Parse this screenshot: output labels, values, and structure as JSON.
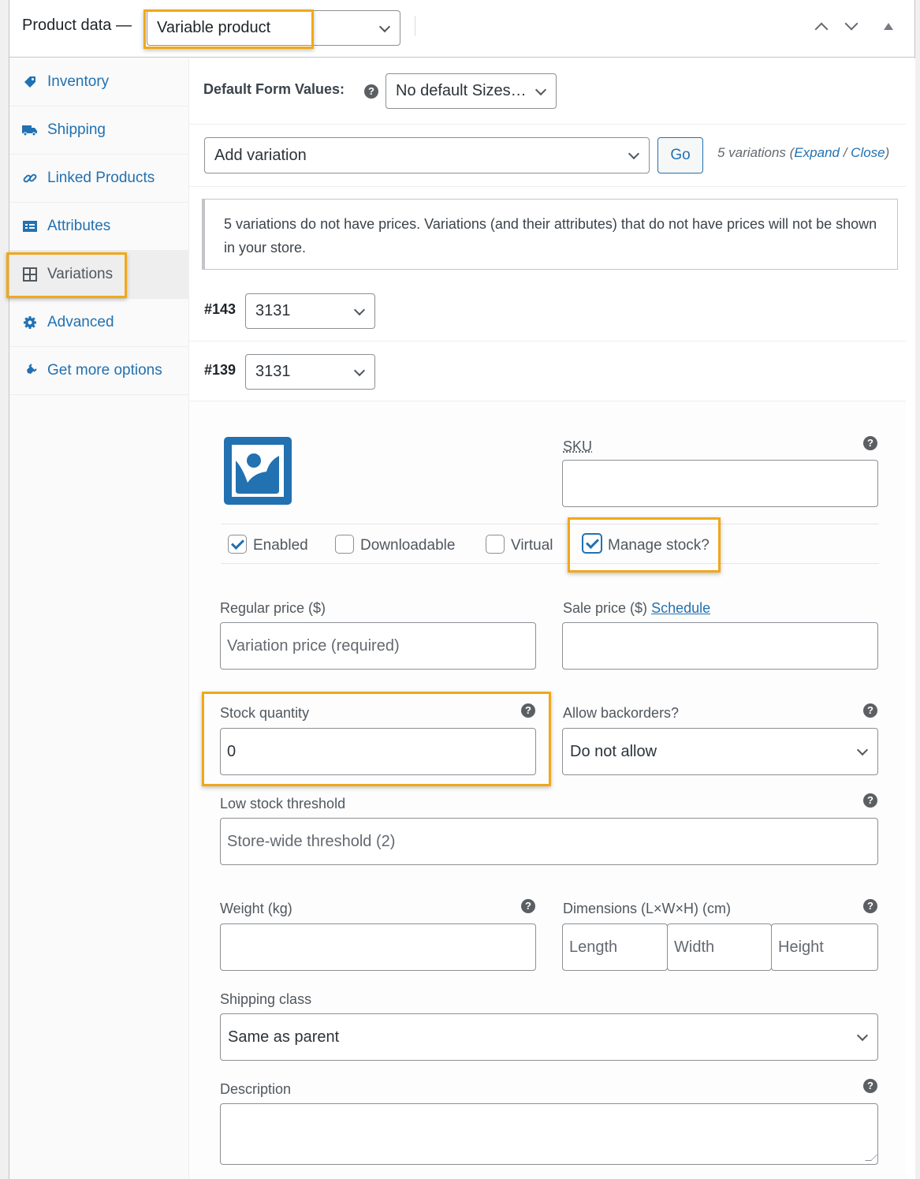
{
  "header": {
    "title": "Product data —",
    "product_type": "Variable product"
  },
  "sidebar": {
    "items": [
      {
        "label": "Inventory",
        "icon": "tag-icon"
      },
      {
        "label": "Shipping",
        "icon": "truck-icon"
      },
      {
        "label": "Linked Products",
        "icon": "link-icon"
      },
      {
        "label": "Attributes",
        "icon": "list-icon"
      },
      {
        "label": "Variations",
        "icon": "grid-icon",
        "active": true
      },
      {
        "label": "Advanced",
        "icon": "gear-icon"
      },
      {
        "label": "Get more options",
        "icon": "plugin-icon"
      }
    ]
  },
  "defaults": {
    "label": "Default Form Values:",
    "select_value": "No default Sizes…"
  },
  "bulk": {
    "action_value": "Add variation",
    "go_label": "Go",
    "count_text": "5 variations",
    "expand_label": "Expand",
    "separator": " / ",
    "close_label": "Close"
  },
  "notice": {
    "text": "5 variations do not have prices. Variations (and their attributes) that do not have prices will not be shown in your store."
  },
  "variations": [
    {
      "id": "#143",
      "value": "3131"
    },
    {
      "id": "#139",
      "value": "3131"
    }
  ],
  "variation_form": {
    "sku_label": "SKU",
    "sku_value": "",
    "checkboxes": [
      {
        "label": "Enabled",
        "checked": true
      },
      {
        "label": "Downloadable",
        "checked": false
      },
      {
        "label": "Virtual",
        "checked": false
      },
      {
        "label": "Manage stock?",
        "checked": true
      }
    ],
    "regular_price_label": "Regular price ($)",
    "regular_price_placeholder": "Variation price (required)",
    "sale_price_label": "Sale price ($)",
    "schedule_label": "Schedule",
    "stock_quantity_label": "Stock quantity",
    "stock_quantity_value": "0",
    "backorders_label": "Allow backorders?",
    "backorders_value": "Do not allow",
    "low_stock_label": "Low stock threshold",
    "low_stock_placeholder": "Store-wide threshold (2)",
    "weight_label": "Weight (kg)",
    "dimensions_label": "Dimensions (L×W×H) (cm)",
    "length_placeholder": "Length",
    "width_placeholder": "Width",
    "height_placeholder": "Height",
    "shipping_class_label": "Shipping class",
    "shipping_class_value": "Same as parent",
    "description_label": "Description",
    "description_value": ""
  },
  "colors": {
    "accent": "#2271b1",
    "highlight": "#f0a81a"
  }
}
